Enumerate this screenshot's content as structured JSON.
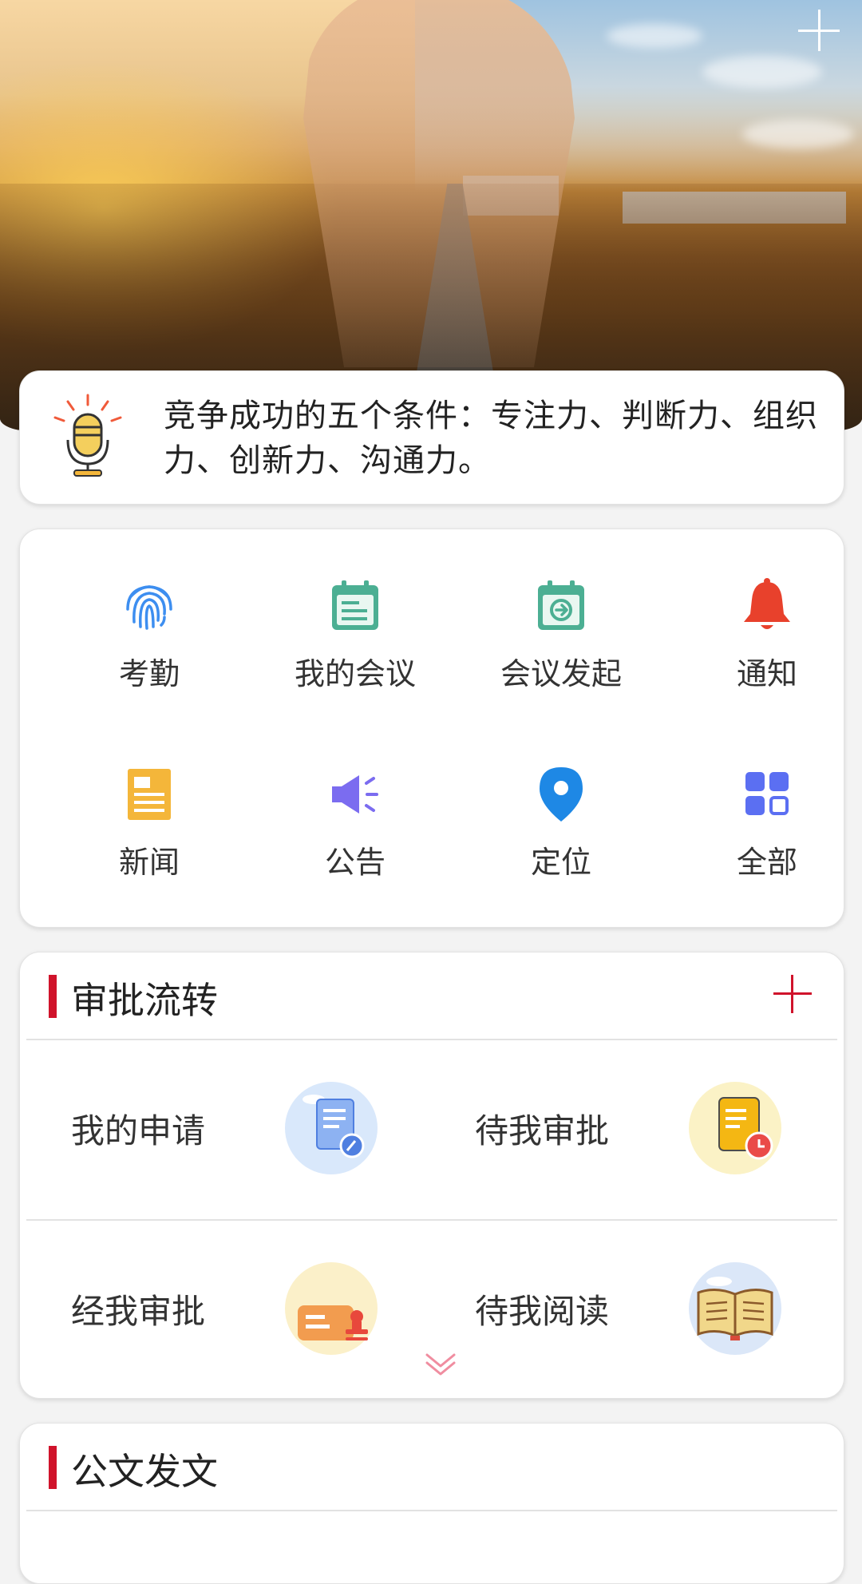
{
  "notice": {
    "text": "竞争成功的五个条件：专注力、判断力、组织力、创新力、沟通力。"
  },
  "quick_menu": [
    {
      "label": "考勤",
      "icon": "fingerprint-icon",
      "color": "#3d8ef0"
    },
    {
      "label": "我的会议",
      "icon": "calendar-list-icon",
      "color": "#4caf93"
    },
    {
      "label": "会议发起",
      "icon": "calendar-arrow-icon",
      "color": "#4caf93"
    },
    {
      "label": "通知",
      "icon": "bell-icon",
      "color": "#e8412c"
    },
    {
      "label": "新闻",
      "icon": "news-icon",
      "color": "#f4b63a"
    },
    {
      "label": "公告",
      "icon": "megaphone-icon",
      "color": "#7b6cf0"
    },
    {
      "label": "定位",
      "icon": "location-pin-icon",
      "color": "#1e88e5"
    },
    {
      "label": "全部",
      "icon": "grid-apps-icon",
      "color": "#5b6ff2"
    }
  ],
  "approval": {
    "title": "审批流转",
    "items": [
      {
        "label": "我的申请",
        "icon": "application-doc-icon"
      },
      {
        "label": "待我审批",
        "icon": "pending-approval-icon"
      },
      {
        "label": "经我审批",
        "icon": "approved-stamp-icon"
      },
      {
        "label": "待我阅读",
        "icon": "open-book-icon"
      }
    ]
  },
  "documents": {
    "title": "公文发文"
  },
  "colors": {
    "accent": "#d0132b",
    "background": "#f3f3f3"
  }
}
